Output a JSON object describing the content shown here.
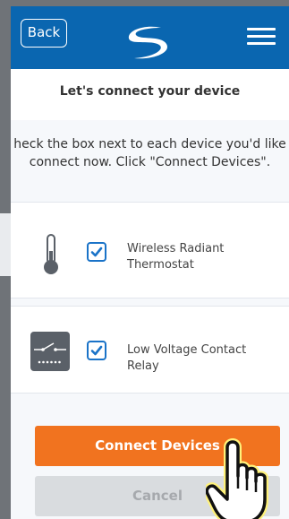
{
  "header": {
    "back_label": "Back"
  },
  "page": {
    "title": "Let's connect your device",
    "instructions": [
      "heck the box next to each device you'd like",
      "connect now. Click \"Connect Devices\"."
    ]
  },
  "devices": [
    {
      "label_lines": [
        "Wireless Radiant",
        "Thermostat"
      ],
      "checked": true,
      "icon": "thermometer-icon"
    },
    {
      "label_lines": [
        "Low Voltage Contact",
        "Relay"
      ],
      "checked": true,
      "icon": "relay-icon"
    }
  ],
  "actions": {
    "connect_label": "Connect Devices",
    "cancel_label": "Cancel"
  },
  "colors": {
    "header": "#0a66b0",
    "accent": "#f1731f",
    "checkbox": "#1a73c8",
    "disabled": "#d9dcdf"
  }
}
